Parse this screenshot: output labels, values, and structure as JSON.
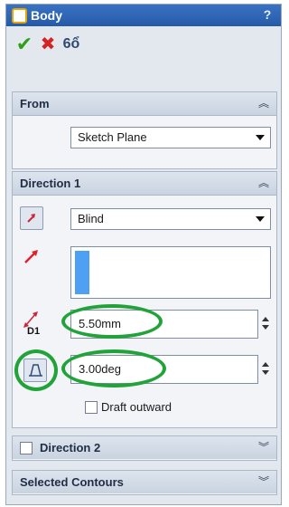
{
  "window": {
    "title": "Body",
    "help_label": "?"
  },
  "actions": {
    "ok": "✔",
    "cancel": "✖",
    "preview": "6ổ"
  },
  "from": {
    "title": "From",
    "selected": "Sketch Plane"
  },
  "direction1": {
    "title": "Direction 1",
    "end_condition": "Blind",
    "depth": "5.50mm",
    "depth_label": "D1",
    "draft_angle": "3.00deg",
    "draft_outward_label": "Draft outward"
  },
  "direction2": {
    "title": "Direction 2"
  },
  "selected_contours": {
    "title": "Selected Contours"
  },
  "colors": {
    "accent": "#22a33a",
    "title_bar": "#255aa8"
  }
}
